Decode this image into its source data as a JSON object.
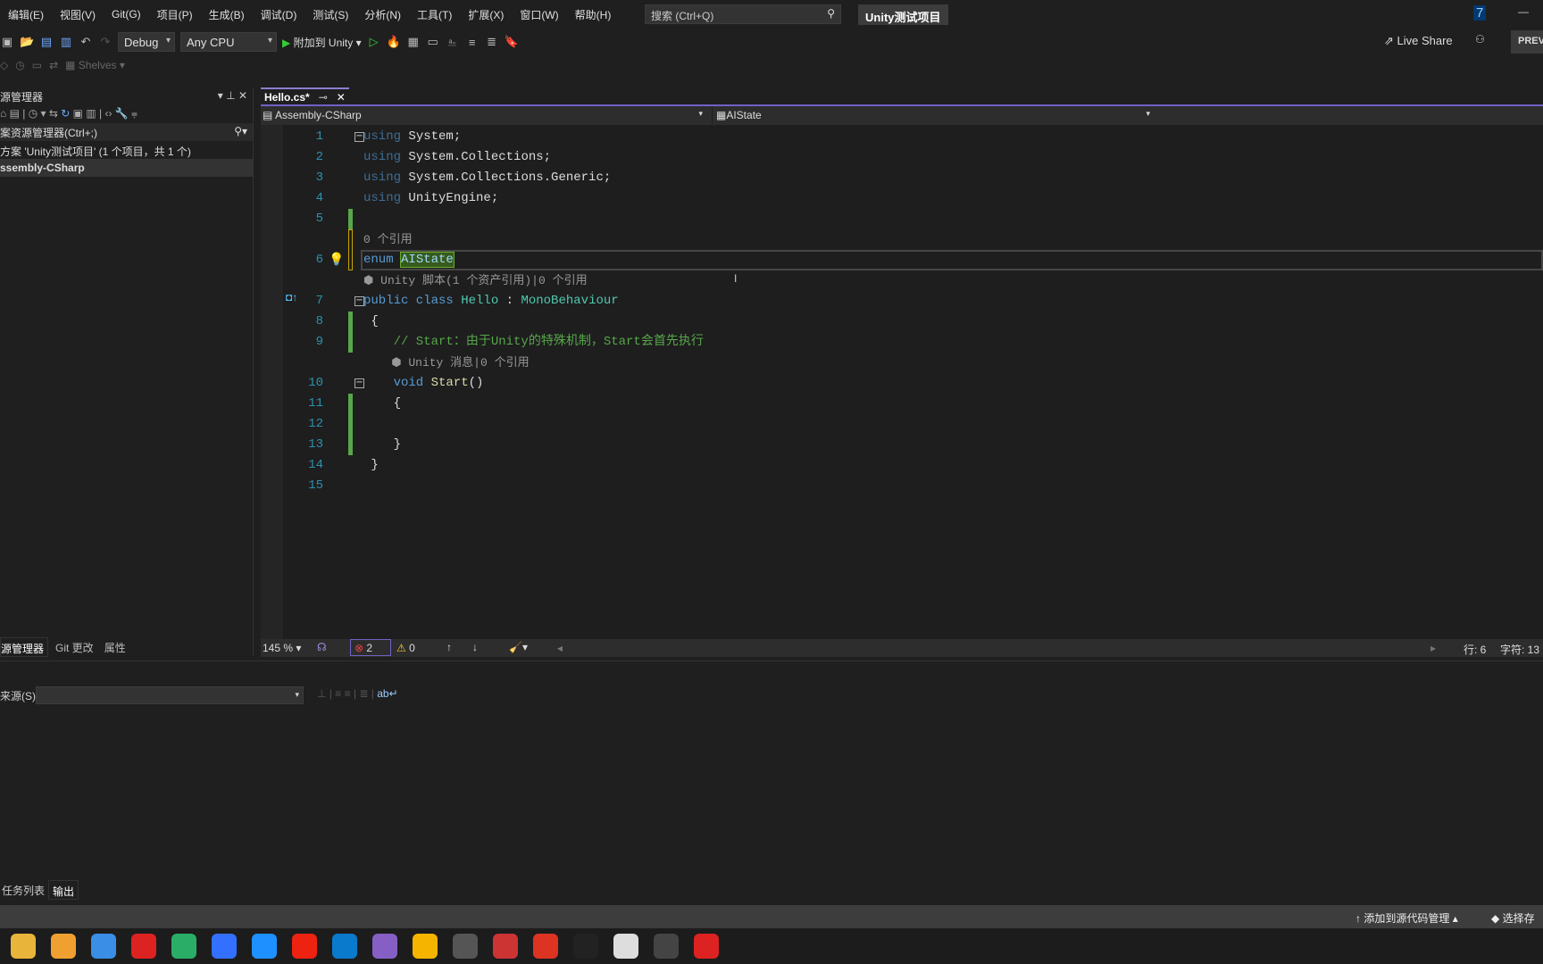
{
  "menu": [
    "编辑(E)",
    "视图(V)",
    "Git(G)",
    "项目(P)",
    "生成(B)",
    "调试(D)",
    "测试(S)",
    "分析(N)",
    "工具(T)",
    "扩展(X)",
    "窗口(W)",
    "帮助(H)"
  ],
  "search_placeholder": "搜索 (Ctrl+Q)",
  "window_title": "Unity测试项目",
  "notification_count": "7",
  "toolbar": {
    "config": "Debug",
    "platform": "Any CPU",
    "attach": "附加到 Unity",
    "live_share": "Live Share",
    "preview": "PREV",
    "shelves": "Shelves"
  },
  "solution_explorer": {
    "title": "源管理器",
    "search": "案资源管理器(Ctrl+;)",
    "items": [
      "方案 'Unity测试项目' (1 个项目，共 1 个)",
      "ssembly-CSharp"
    ],
    "tabs": [
      "源管理器",
      "Git 更改",
      "属性"
    ]
  },
  "editor": {
    "tab": "Hello.cs*",
    "nav_left": "Assembly-CSharp",
    "nav_right": "AIState",
    "rows": [
      {
        "n": "1",
        "fold": true,
        "seg": [
          [
            "kwdim",
            "using "
          ],
          [
            "id",
            "System;"
          ]
        ]
      },
      {
        "n": "2",
        "seg": [
          [
            "kwdim",
            "using "
          ],
          [
            "id",
            "System.Collections;"
          ]
        ]
      },
      {
        "n": "3",
        "seg": [
          [
            "kwdim",
            "using "
          ],
          [
            "id",
            "System.Collections.Generic;"
          ]
        ]
      },
      {
        "n": "4",
        "seg": [
          [
            "kwdim",
            "using "
          ],
          [
            "id",
            "UnityEngine;"
          ]
        ]
      },
      {
        "n": "5",
        "seg": []
      },
      {
        "n": "",
        "lens": "0 个引用"
      },
      {
        "n": "6",
        "cur": true,
        "seg": [
          [
            "kw",
            "enum "
          ],
          [
            "hl",
            "AIState"
          ]
        ]
      },
      {
        "n": "",
        "lens": "⬢ Unity 脚本(1 个资产引用)|0 个引用"
      },
      {
        "n": "7",
        "fold": true,
        "seg": [
          [
            "kw",
            "public class "
          ],
          [
            "tp",
            "Hello"
          ],
          [
            "id",
            " : "
          ],
          [
            "tp",
            "MonoBehaviour"
          ]
        ]
      },
      {
        "n": "8",
        "seg": [
          [
            "id",
            " {"
          ]
        ]
      },
      {
        "n": "9",
        "seg": [
          [
            "cm",
            "    // Start：由于Unity的特殊机制，Start会首先执行"
          ]
        ]
      },
      {
        "n": "",
        "lens": "    ⬢ Unity 消息|0 个引用"
      },
      {
        "n": "10",
        "fold": true,
        "seg": [
          [
            "kw",
            "    void "
          ],
          [
            "fn",
            "Start"
          ],
          [
            "id",
            "()"
          ]
        ]
      },
      {
        "n": "11",
        "seg": [
          [
            "id",
            "    {"
          ]
        ]
      },
      {
        "n": "12",
        "seg": []
      },
      {
        "n": "13",
        "seg": [
          [
            "id",
            "    }"
          ]
        ]
      },
      {
        "n": "14",
        "seg": [
          [
            "id",
            " }"
          ]
        ]
      },
      {
        "n": "15",
        "seg": []
      }
    ],
    "zoom": "145 %",
    "errors": "2",
    "warnings": "0",
    "line": "行: 6",
    "col": "字符: 13"
  },
  "output": {
    "source_label": "来源(S):"
  },
  "bottom_tabs": [
    "任务列表",
    "输出"
  ],
  "status": {
    "source_control": "添加到源代码管理",
    "repo": "选择存"
  },
  "taskbar": [
    {
      "icon": "file-explorer-icon",
      "color": "#e8b53a"
    },
    {
      "icon": "app-orange-icon",
      "color": "#f0a030"
    },
    {
      "icon": "chrome-icon",
      "color": "#3a8ee6"
    },
    {
      "icon": "record-icon",
      "color": "#d22"
    },
    {
      "icon": "wechat-icon",
      "color": "#2aae67"
    },
    {
      "icon": "feishu-icon",
      "color": "#3370ff"
    },
    {
      "icon": "app-blue-icon",
      "color": "#1e90ff"
    },
    {
      "icon": "youdao-icon",
      "color": "#e21"
    },
    {
      "icon": "vscode-icon",
      "color": "#0a7acc"
    },
    {
      "icon": "visual-studio-icon",
      "color": "#865fc5"
    },
    {
      "icon": "app-grid-icon",
      "color": "#f4b400"
    },
    {
      "icon": "unity-hub-icon",
      "color": "#555"
    },
    {
      "icon": "app-red-icon",
      "color": "#c33"
    },
    {
      "icon": "wps-icon",
      "color": "#d32"
    },
    {
      "icon": "qq-icon",
      "color": "#222"
    },
    {
      "icon": "chat-icon",
      "color": "#ddd"
    },
    {
      "icon": "unity-icon",
      "color": "#444"
    },
    {
      "icon": "record2-icon",
      "color": "#d22"
    }
  ]
}
